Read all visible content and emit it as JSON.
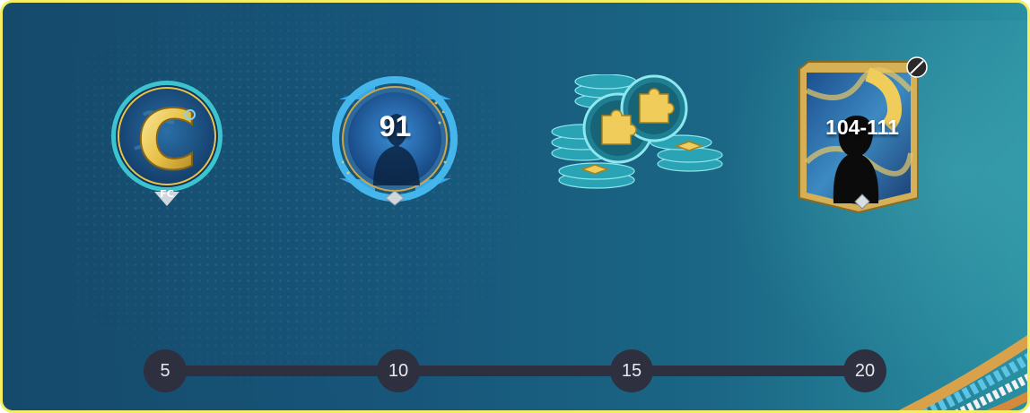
{
  "rewards": [
    {
      "icon": "captain-badge-icon",
      "label": ""
    },
    {
      "icon": "player-pick-medallion-icon",
      "label": "91"
    },
    {
      "icon": "puzzle-token-stack-icon",
      "label": ""
    },
    {
      "icon": "player-card-icon",
      "label": "104-111"
    }
  ],
  "milestones": [
    "5",
    "10",
    "15",
    "20"
  ],
  "colors": {
    "border": "#f6ee62",
    "track": "#2e2f3f",
    "gold": "#e8c34a",
    "teal": "#38b8c8"
  }
}
